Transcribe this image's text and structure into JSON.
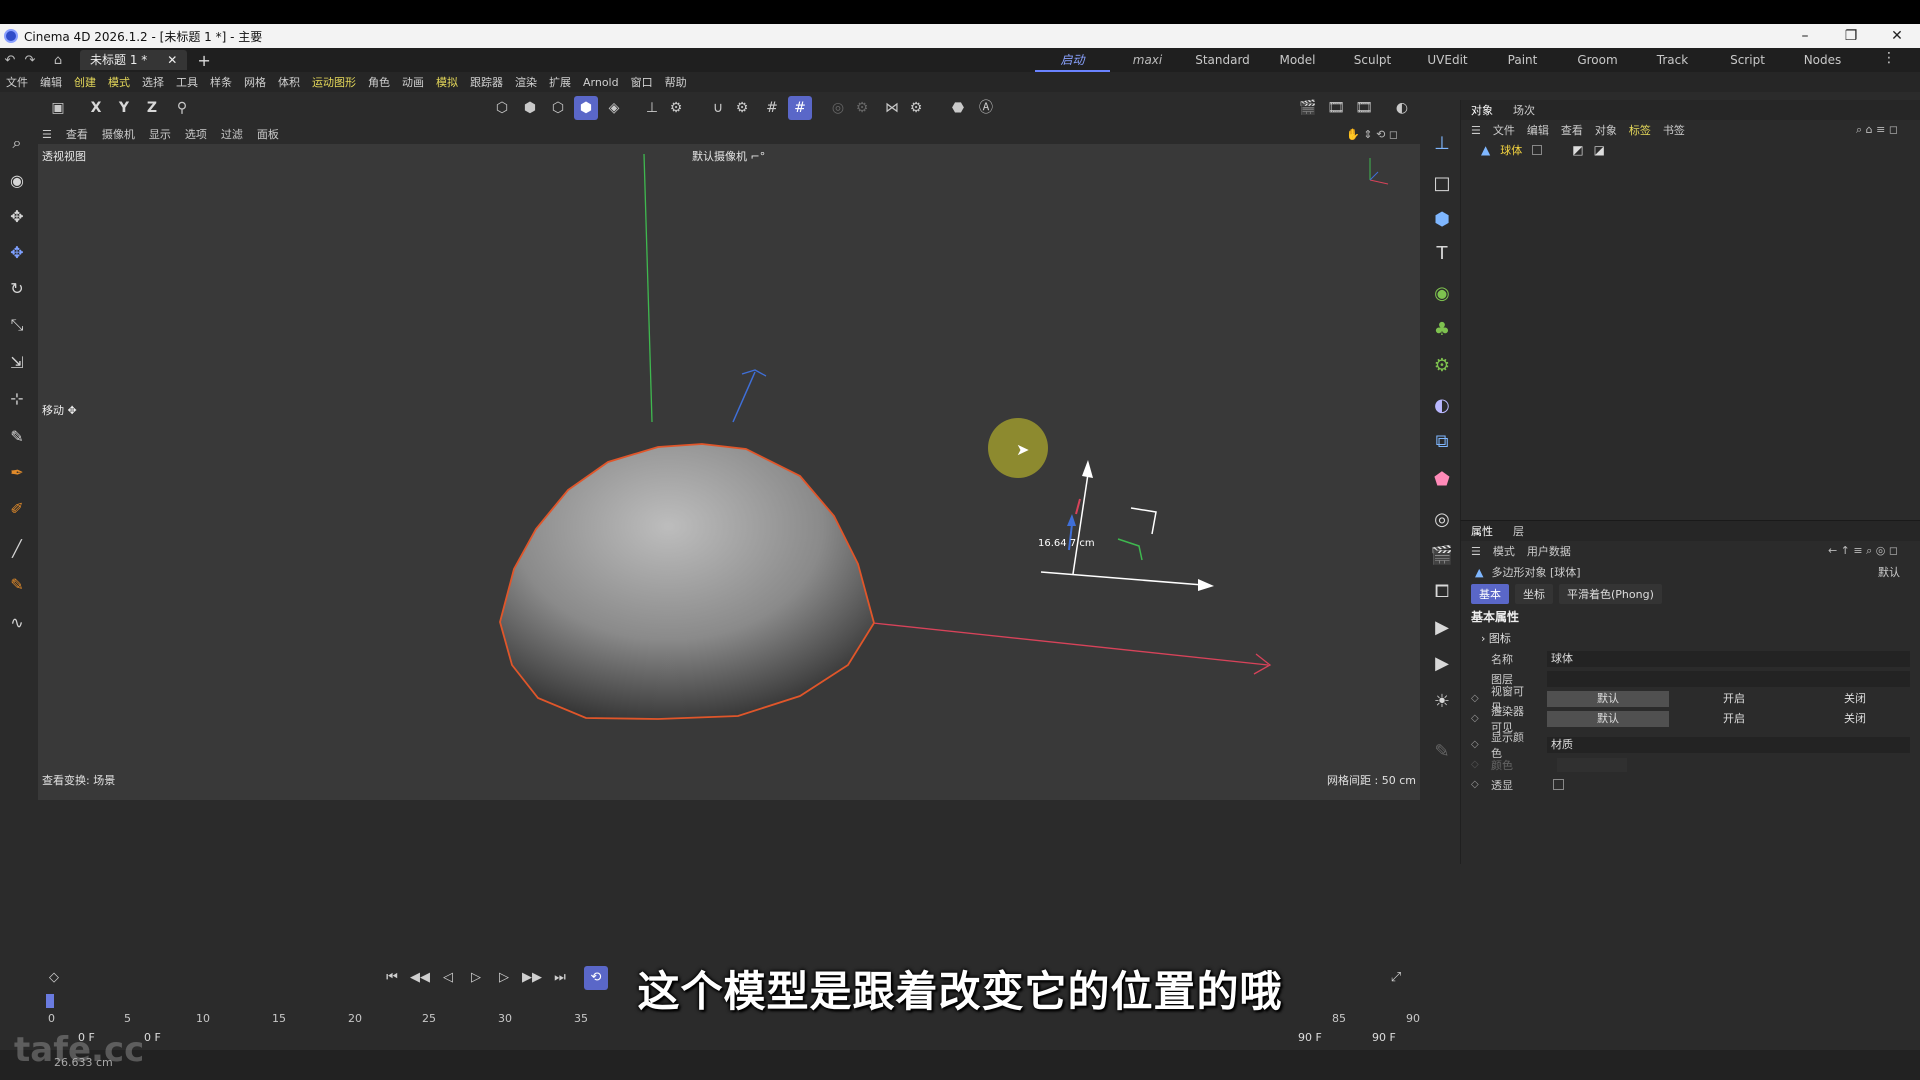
{
  "window": {
    "title": "Cinema 4D 2026.1.2 - [未标题 1 *] - 主要",
    "controls": [
      "–",
      "❐",
      "✕"
    ]
  },
  "doc_tab": {
    "label": "未标题 1 *",
    "close": "✕",
    "add": "+"
  },
  "layouts": [
    "启动",
    "maxi",
    "Standard",
    "Model",
    "Sculpt",
    "UVEdit",
    "Paint",
    "Groom",
    "Track",
    "Script",
    "Nodes"
  ],
  "menu": [
    "文件",
    "编辑",
    "创建",
    "模式",
    "选择",
    "工具",
    "样条",
    "网格",
    "体积",
    "运动图形",
    "角色",
    "动画",
    "模拟",
    "跟踪器",
    "渲染",
    "扩展",
    "Arnold",
    "窗口",
    "帮助"
  ],
  "toolbar": {
    "axis_x": "X",
    "axis_y": "Y",
    "axis_z": "Z"
  },
  "viewport_menu": [
    "查看",
    "摄像机",
    "显示",
    "选项",
    "过滤",
    "面板"
  ],
  "viewport": {
    "name": "透视视图",
    "camera": "默认摄像机 ⌐°",
    "tool_label": "移动 ✥",
    "distance": "16.64 7 cm",
    "footer_left": "查看变换: 场景",
    "footer_right": "网格间距 : 50 cm"
  },
  "object_manager": {
    "tabs": [
      "对象",
      "场次"
    ],
    "menu": [
      "文件",
      "编辑",
      "查看",
      "对象",
      "标签",
      "书签"
    ],
    "object_name": "球体"
  },
  "attribute_manager": {
    "tabs": [
      "属性",
      "层"
    ],
    "menu": [
      "模式",
      "用户数据"
    ],
    "object_type": "多边形对象 [球体]",
    "preset": "默认",
    "subtabs": [
      "基本",
      "坐标",
      "平滑着色(Phong)"
    ],
    "section": "基本属性",
    "group": "图标",
    "props": {
      "name_label": "名称",
      "name_value": "球体",
      "layer_label": "图层",
      "vis_editor_label": "视窗可见",
      "vis_render_label": "渲染器可见",
      "opt_default": "默认",
      "opt_on": "开启",
      "opt_off": "关闭",
      "display_color_label": "显示颜色",
      "display_color_value": "材质",
      "color_label": "颜色",
      "xray_label": "透显"
    }
  },
  "timeline": {
    "ticks": [
      "0",
      "5",
      "10",
      "15",
      "20",
      "25",
      "30",
      "35",
      "85",
      "90"
    ],
    "start_a": "0 F",
    "start_b": "0 F",
    "end_a": "90 F",
    "end_b": "90 F"
  },
  "status": {
    "text": "26.633 cm"
  },
  "watermark": "tafe.cc",
  "subtitle": "这个模型是跟着改变它的位置的哦",
  "colors": {
    "accent": "#5a67c8",
    "selection_outline": "#e0562a",
    "axis_x": "#d8435a",
    "axis_y": "#3fb84f",
    "axis_z": "#3f6fd8"
  }
}
